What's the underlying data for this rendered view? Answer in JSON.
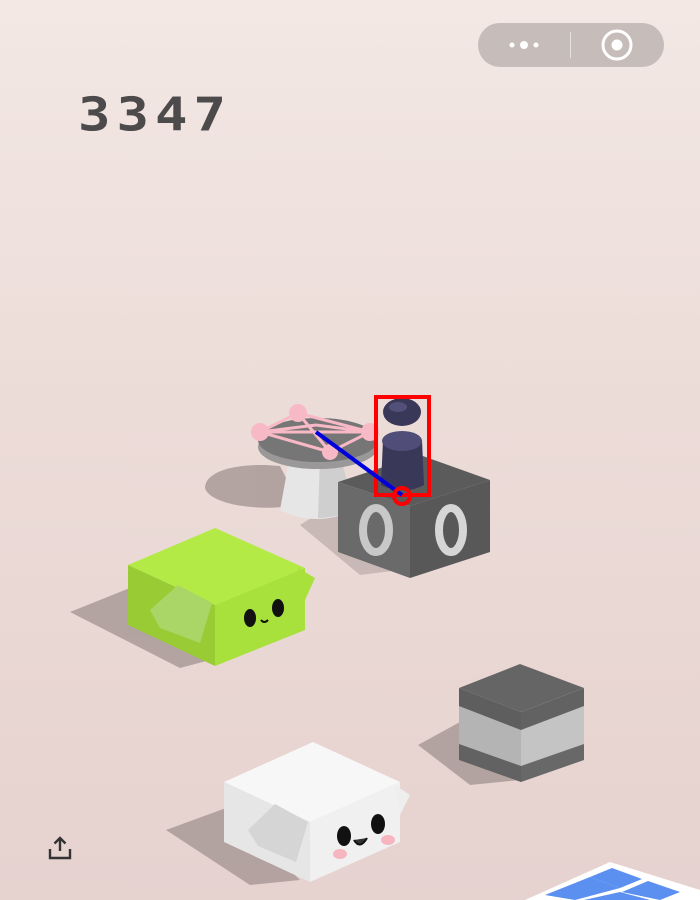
{
  "score": "3347",
  "menu_capsule": {
    "more_icon": "more-dots-icon",
    "close_icon": "target-circle-icon"
  },
  "share_icon": "share-upload-icon",
  "colors": {
    "background_top": "#f3e8e4",
    "background_bottom": "#e6d2cf",
    "score_text": "#4c4a4a",
    "green_box": "#b6ec45",
    "white_box": "#f4f4f4",
    "dark_box": "#5e5e5e",
    "player_piece": "#3a3858",
    "highlight_box": "#ff0000",
    "aim_line": "#0000dd",
    "pose_keypoints": "#f8b9c6",
    "blue_tile": "#5b8ff0"
  }
}
